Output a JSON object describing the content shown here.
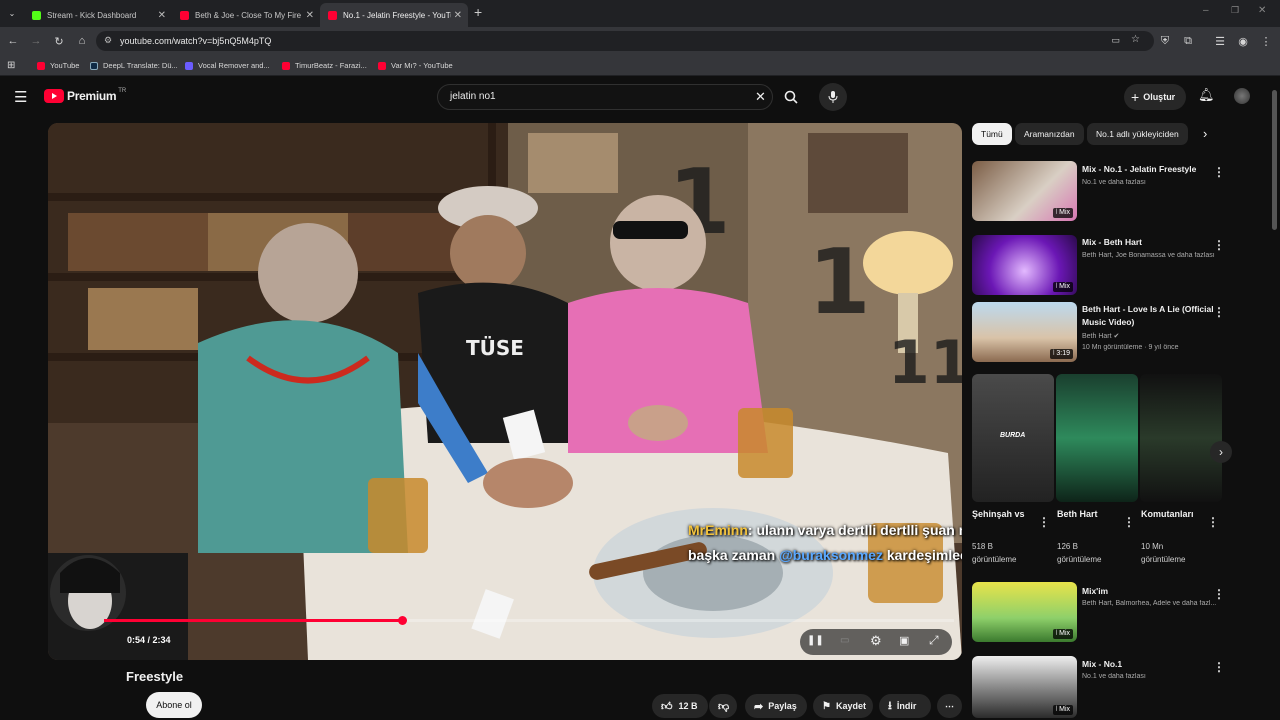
{
  "browser": {
    "tabs": [
      {
        "title": "Stream - Kick Dashboard",
        "icon": "kick-icon",
        "color": "#53fc18"
      },
      {
        "title": "Beth & Joe - Close To My Fire",
        "icon": "youtube-icon",
        "color": "#ff0033"
      },
      {
        "title": "No.1 - Jelatin Freestyle - YouTube",
        "icon": "youtube-icon",
        "color": "#ff0033"
      }
    ],
    "url": "youtube.com/watch?v=bj5nQ5M4pTQ",
    "bookmarks": [
      {
        "label": "YouTube",
        "color": "#ff0033"
      },
      {
        "label": "DeepL Translate: Dü...",
        "color": "#0f2b46"
      },
      {
        "label": "Vocal Remover and...",
        "color": "#6b5cff"
      },
      {
        "label": "TimurBeatz - Farazi...",
        "color": "#ff0033"
      },
      {
        "label": "Var Mı? - YouTube",
        "color": "#ff0033"
      }
    ]
  },
  "youtube": {
    "logo_text": "Premium",
    "logo_sup": "TR",
    "search_value": "jelatin no1",
    "create_label": "Oluştur",
    "accent": "#ff0033"
  },
  "player": {
    "time": "0:54 / 2:34",
    "progress": 0.35,
    "chat": {
      "user1": "MrEminn",
      "msg1": ": ulann varya dertlli dertlli şuan ne kafama sikerimde bu gece olmazz,",
      "msg2a": "başka zaman ",
      "mention": "@buraksonmez",
      "msg2b": " kardeşimlee"
    }
  },
  "video": {
    "title": "Freestyle",
    "subscribe_label": "Abone ol",
    "like_count": "12 B",
    "share_label": "Paylaş",
    "save_label": "Kaydet",
    "download_label": "İndir"
  },
  "sidebar": {
    "chips": [
      "Tümü",
      "Aramanızdan",
      "No.1 adlı yükleyiciden"
    ],
    "items": [
      {
        "title": "Mix - No.1 - Jelatin Freestyle",
        "meta": "No.1 ve daha fazlası",
        "badge": "Mix"
      },
      {
        "title": "Mix - Beth Hart",
        "meta": "Beth Hart, Joe Bonamassa ve daha fazlası",
        "badge": "Mix"
      },
      {
        "title": "Beth Hart - Love Is A Lie (Official Music Video)",
        "meta": "Beth Hart",
        "meta2": "10 Mn görüntüleme · 9 yıl önce",
        "badge": "3:19"
      },
      {
        "title": "Mix'im",
        "meta": "Beth Hart, Balmorhea, Adele ve daha fazl...",
        "badge": "Mix"
      },
      {
        "title": "Mix - No.1",
        "meta": "No.1 ve daha fazlası",
        "badge": "Mix"
      }
    ],
    "shorts": [
      {
        "title": "Şehinşah vs",
        "views": "518 B",
        "views2": "görüntüleme",
        "overlay": "BURDA"
      },
      {
        "title": "Beth Hart",
        "views": "126 B",
        "views2": "görüntüleme"
      },
      {
        "title": "Komutanları",
        "views": "10 Mn",
        "views2": "görüntüleme"
      }
    ]
  }
}
